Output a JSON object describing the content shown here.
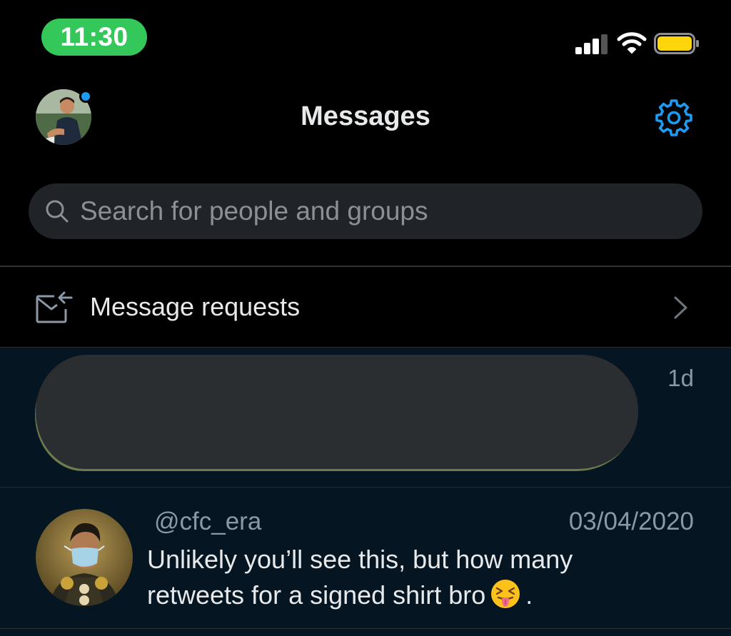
{
  "status_bar": {
    "time": "11:30",
    "time_pill_color": "#34c759",
    "signal_icon": "cellular-signal-icon",
    "wifi_icon": "wifi-icon",
    "battery_icon": "battery-icon",
    "battery_color": "#ffd60a"
  },
  "header": {
    "title": "Messages",
    "avatar_icon": "profile-avatar",
    "notification_dot_color": "#1d9bf0",
    "settings_icon": "gear-icon"
  },
  "search": {
    "placeholder": "Search for people and groups",
    "value": ""
  },
  "requests": {
    "label": "Message requests",
    "icon": "envelope-arrow-icon"
  },
  "conversations": [
    {
      "redacted": true,
      "time": "1d"
    },
    {
      "handle": "@cfc_era",
      "date": "03/04/2020",
      "preview_text": "Unlikely you’ll see this, but how many retweets for a signed shirt bro",
      "preview_end": ".",
      "emoji": "squinting-tongue-emoji"
    }
  ],
  "colors": {
    "accent": "#1d9bf0",
    "background": "#000000",
    "conversation_background": "#051521"
  }
}
